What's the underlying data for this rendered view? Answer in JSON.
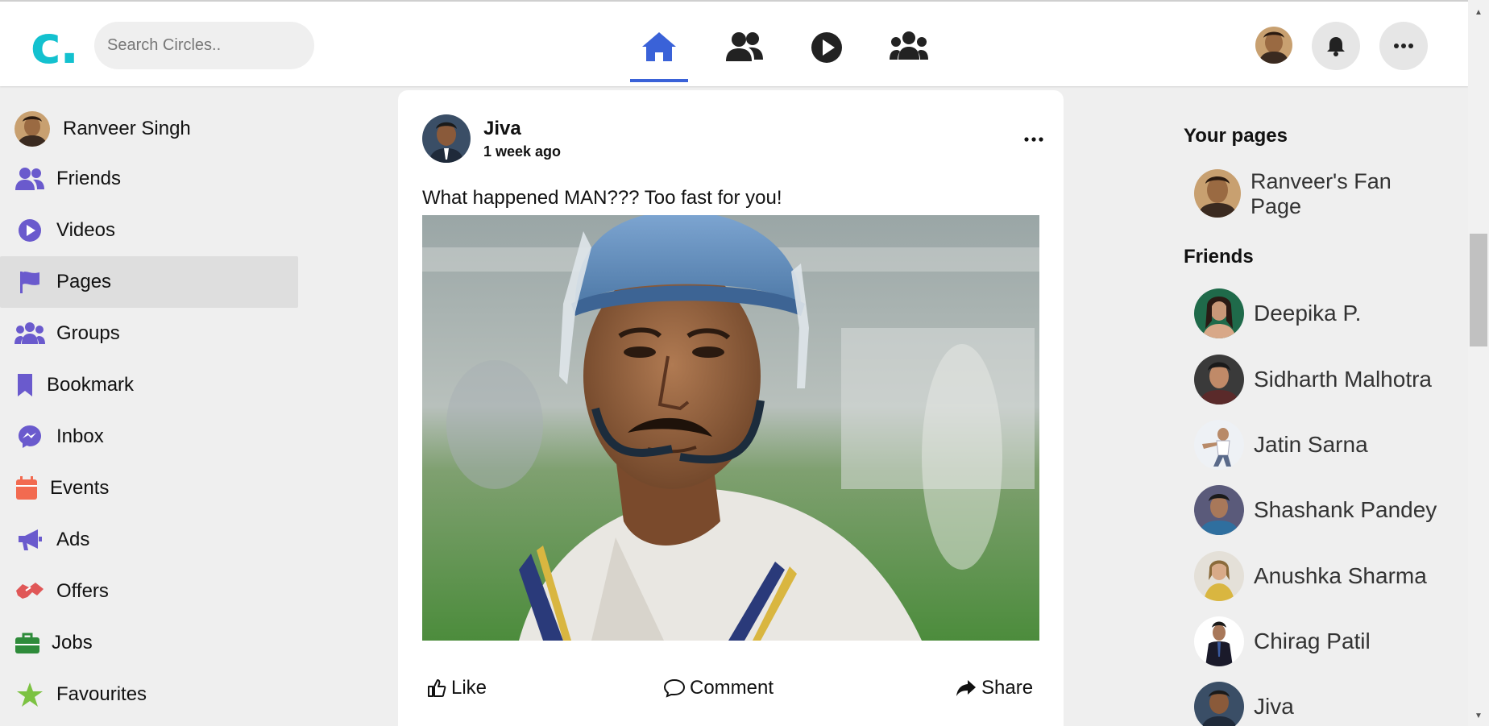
{
  "header": {
    "logo": "c.",
    "search_placeholder": "Search Circles..",
    "nav": [
      "home-icon",
      "friends-icon",
      "watch-icon",
      "groups-icon"
    ],
    "active_nav": "home",
    "accent": "#3a62d8",
    "logo_color": "#13c1cf"
  },
  "sidebar": {
    "profile_name": "Ranveer Singh",
    "items": [
      {
        "label": "Friends",
        "icon": "friends-icon",
        "color": "#6a5acd"
      },
      {
        "label": "Videos",
        "icon": "play-circle-icon",
        "color": "#6a5acd"
      },
      {
        "label": "Pages",
        "icon": "flag-icon",
        "color": "#6a5acd",
        "active": true
      },
      {
        "label": "Groups",
        "icon": "groups-icon",
        "color": "#6a5acd"
      },
      {
        "label": "Bookmark",
        "icon": "bookmark-icon",
        "color": "#6a5acd"
      },
      {
        "label": "Inbox",
        "icon": "messenger-icon",
        "color": "#6a5acd"
      },
      {
        "label": "Events",
        "icon": "calendar-icon",
        "color": "#f26a50"
      },
      {
        "label": "Ads",
        "icon": "megaphone-icon",
        "color": "#6a5acd"
      },
      {
        "label": "Offers",
        "icon": "handshake-icon",
        "color": "#e05757"
      },
      {
        "label": "Jobs",
        "icon": "briefcase-icon",
        "color": "#2e8b3a"
      },
      {
        "label": "Favourites",
        "icon": "star-icon",
        "color": "#7cc242"
      }
    ]
  },
  "post": {
    "author": "Jiva",
    "time": "1 week ago",
    "text": "What happened MAN??? Too fast for you!",
    "actions": {
      "like": "Like",
      "comment": "Comment",
      "share": "Share"
    }
  },
  "right": {
    "pages_heading": "Your pages",
    "page_name": "Ranveer's Fan Page",
    "friends_heading": "Friends",
    "friends": [
      "Deepika P.",
      "Sidharth Malhotra",
      "Jatin Sarna",
      "Shashank Pandey",
      "Anushka Sharma",
      "Chirag Patil",
      "Jiva"
    ]
  }
}
